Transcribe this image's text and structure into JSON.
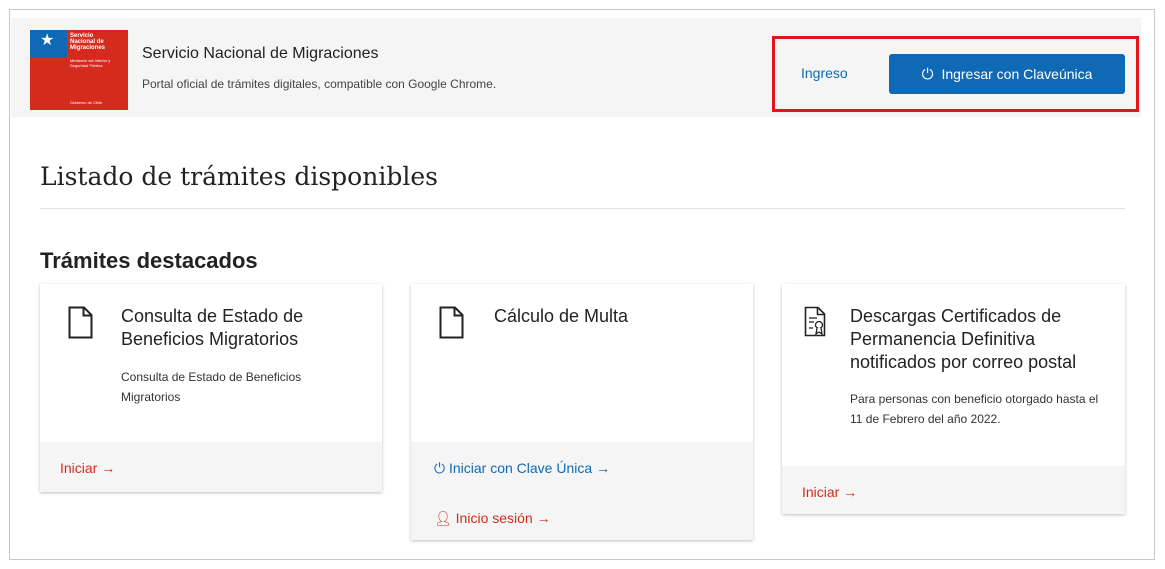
{
  "header": {
    "logo": {
      "line1": "Servicio",
      "line2": "Nacional de",
      "line3": "Migraciones",
      "ministry": "Ministerio del Interior y Seguridad Pública",
      "gov": "Gobierno de Chile"
    },
    "title": "Servicio Nacional de Migraciones",
    "subtitle": "Portal oficial de trámites digitales, compatible con Google Chrome.",
    "login_link": "Ingreso",
    "claveunica_button": "Ingresar con Claveúnica"
  },
  "page_title": "Listado de trámites disponibles",
  "section_title": "Trámites destacados",
  "cards": [
    {
      "title": "Consulta de Estado de Beneficios Migratorios",
      "description": "Consulta de Estado de Beneficios Migratorios",
      "action": "Iniciar →"
    },
    {
      "title": "Cálculo de Multa",
      "description": "",
      "action_clave": "Iniciar con Clave Única →",
      "action_session": "Inicio sesión →"
    },
    {
      "title": "Descargas Certificados de Permanencia Definitiva notificados por correo postal",
      "description": "Para personas con beneficio otorgado hasta el 11 de Febrero del año 2022.",
      "action": "Iniciar →"
    }
  ],
  "colors": {
    "primary_blue": "#0f69b4",
    "accent_red": "#d52b1e",
    "highlight_red": "#e4141d"
  }
}
